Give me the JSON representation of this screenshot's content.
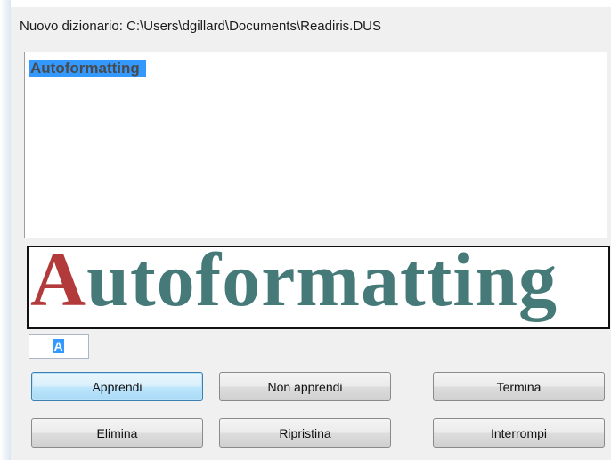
{
  "window": {
    "title": "Nuovo dizionario: C:\\Users\\dgillard\\Documents\\Readiris.DUS"
  },
  "word_list": {
    "items": [
      "Autoformatting"
    ]
  },
  "preview": {
    "first_letter": "A",
    "rest": "utoformatting",
    "colors": {
      "first_letter": "#b23a3a",
      "rest": "#457a78"
    }
  },
  "char_field": {
    "value": "A"
  },
  "buttons": {
    "apprendi": "Apprendi",
    "non_apprendi": "Non apprendi",
    "termina": "Termina",
    "elimina": "Elimina",
    "ripristina": "Ripristina",
    "interrompi": "Interrompi"
  },
  "colors": {
    "selection": "#3399ff",
    "dialog_bg": "#f0f0f0"
  }
}
